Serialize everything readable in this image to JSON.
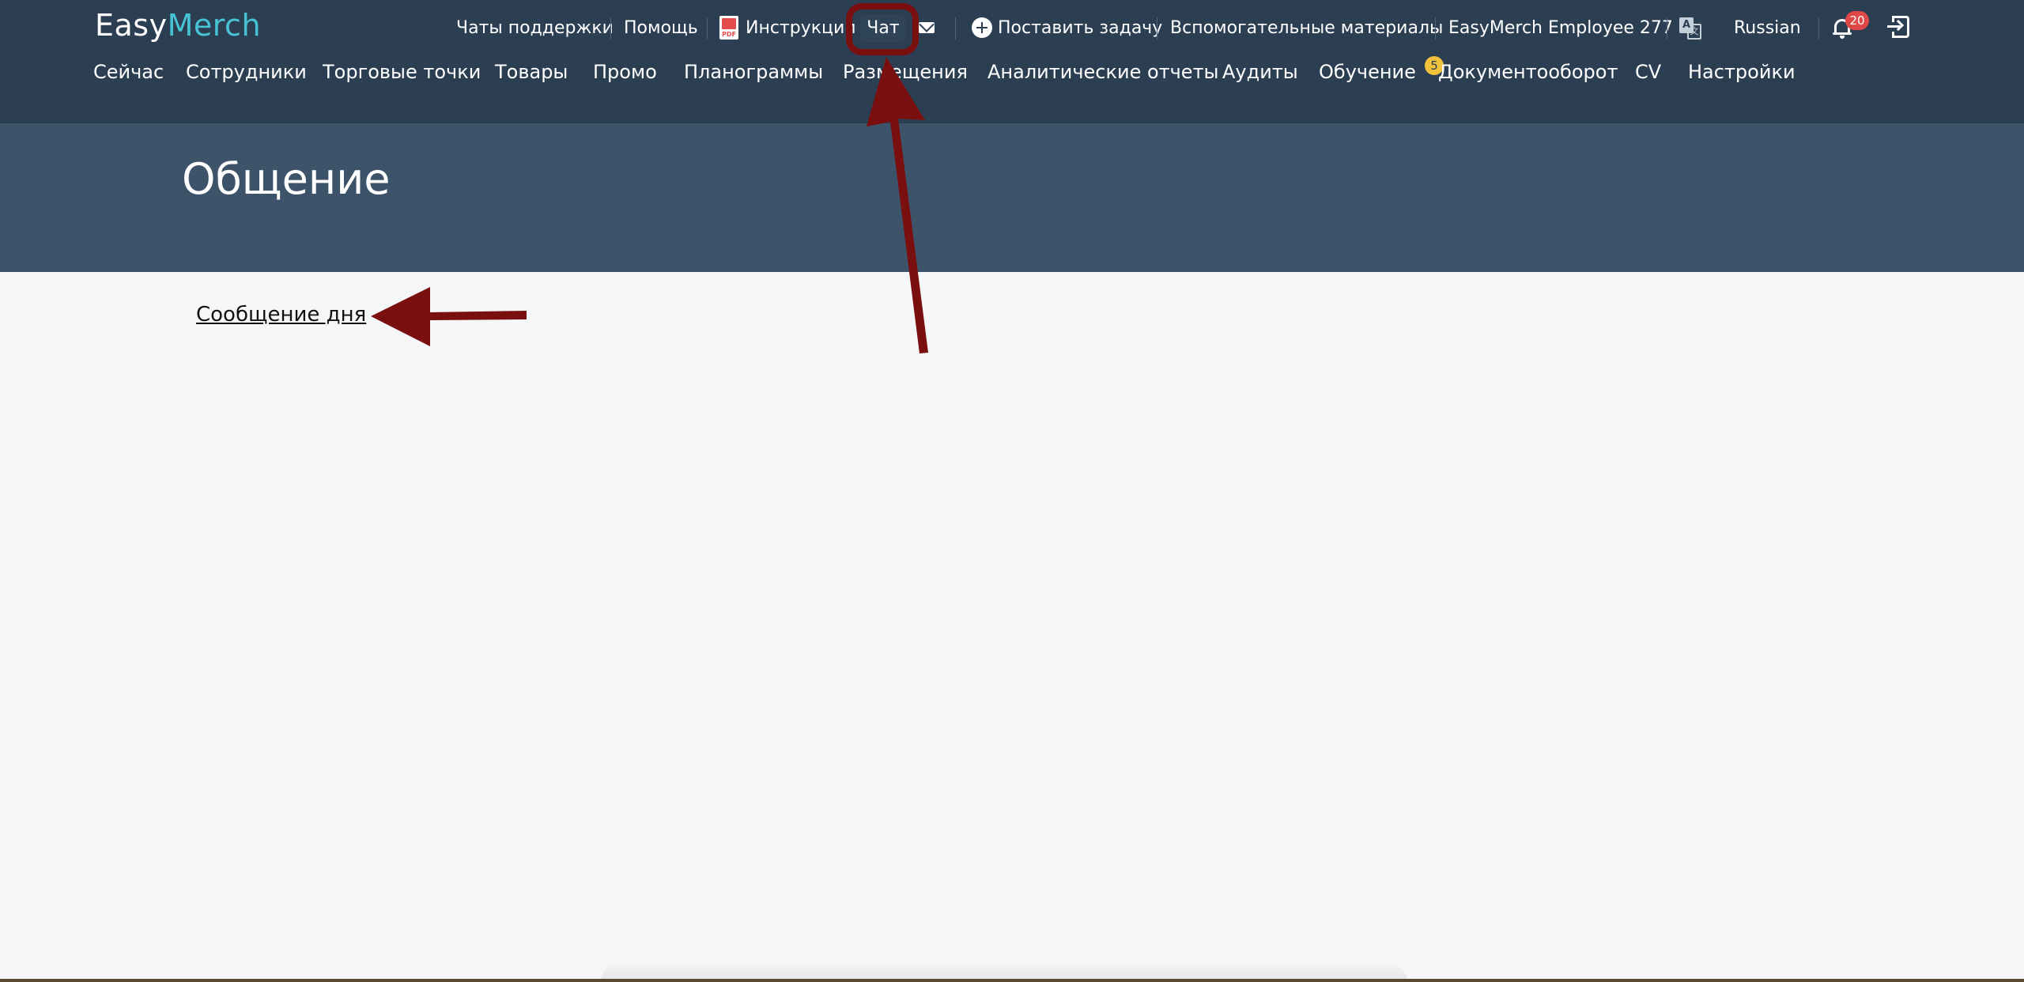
{
  "brand": {
    "part1": "Easy",
    "part2": "Merch"
  },
  "utility_nav": {
    "support_chats": "Чаты поддержки",
    "help": "Помощь",
    "instructions": "Инструкции",
    "chat": "Чат",
    "create_task": "Поставить задачу",
    "materials": "Вспомогательные материалы",
    "user": "EasyMerch Employee 277",
    "language": "Russian",
    "notifications_count": "20"
  },
  "main_nav": {
    "items": [
      "Сейчас",
      "Сотрудники",
      "Торговые точки",
      "Товары",
      "Промо",
      "Планограммы",
      "Размещения",
      "Аналитические отчеты",
      "Аудиты",
      "Обучение",
      "Документооборот",
      "CV",
      "Настройки"
    ],
    "documents_badge": "5"
  },
  "page": {
    "title": "Общение",
    "message_of_day_link": "Сообщение дня"
  },
  "colors": {
    "topbar": "#2c3e52",
    "page_header": "#3d5369",
    "content_bg": "#f4f6f8",
    "brand_accent": "#48c3d6",
    "annotation": "#7a0f0f",
    "notification_badge": "#e04848",
    "counter_badge": "#f0c23c"
  },
  "icons": [
    "pdf-icon",
    "mail-icon",
    "plus-circle-icon",
    "translate-icon",
    "bell-icon",
    "logout-icon"
  ]
}
